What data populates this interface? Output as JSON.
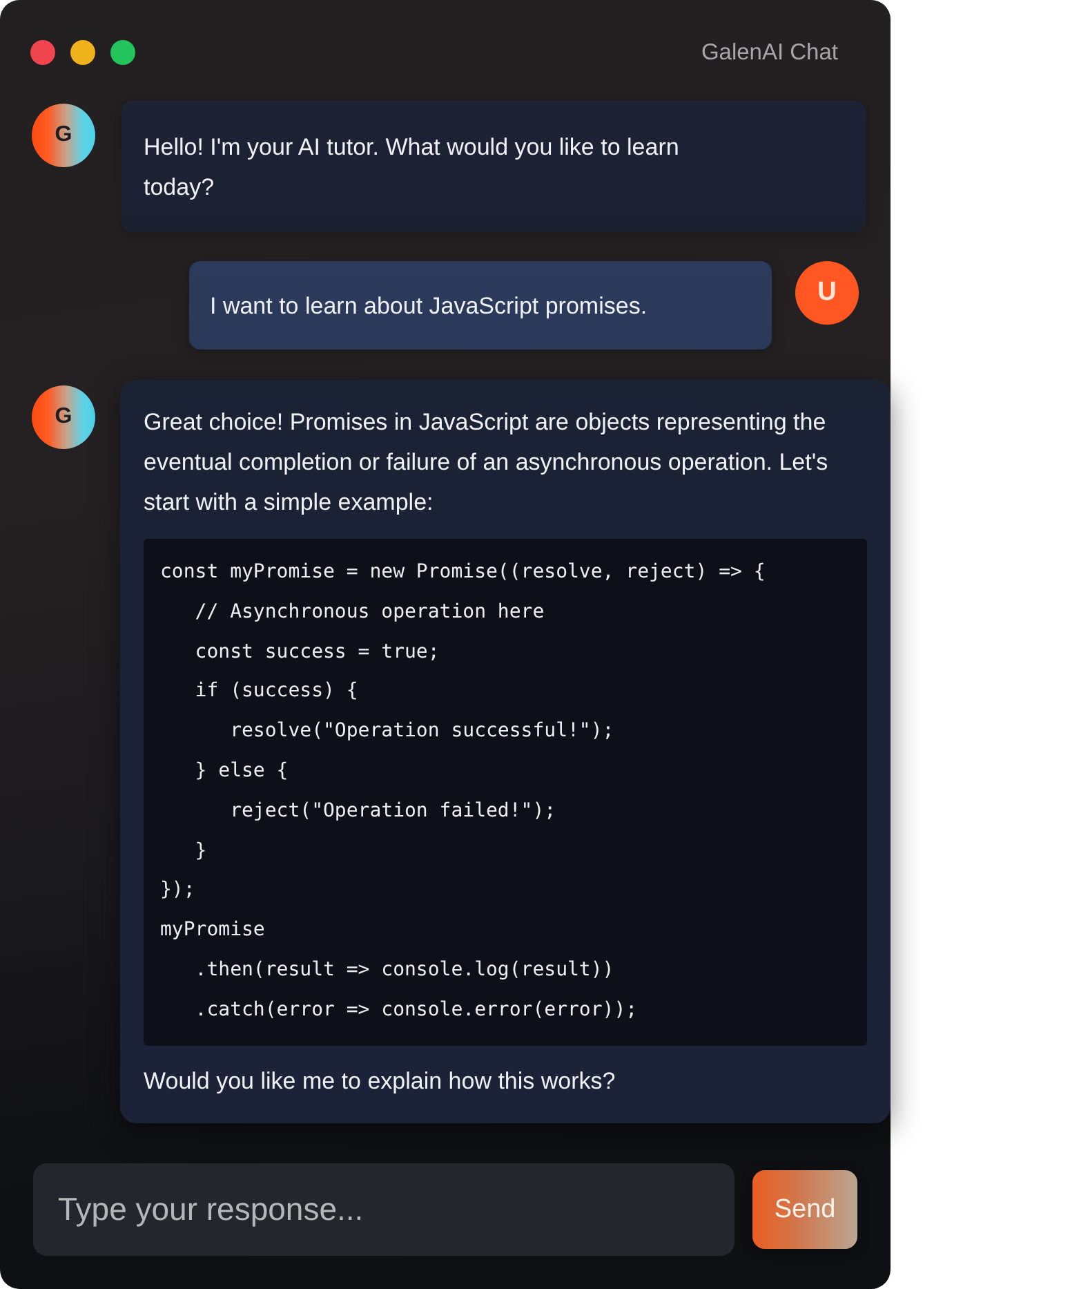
{
  "window": {
    "title": "GalenAI Chat",
    "window_buttons": [
      {
        "kind": "close"
      },
      {
        "kind": "minimize"
      },
      {
        "kind": "zoom"
      }
    ]
  },
  "messages": [
    {
      "kind": "assistant",
      "avatar": "G",
      "blocks": [
        {
          "kind": "text",
          "text": "Hello! I'm your AI tutor. What would you like to learn today?"
        }
      ]
    },
    {
      "kind": "user",
      "avatar": "U",
      "blocks": [
        {
          "kind": "text",
          "text": "I want to learn about JavaScript promises."
        }
      ]
    },
    {
      "kind": "assistant",
      "avatar": "G",
      "blocks": [
        {
          "kind": "text",
          "text": "Great choice! Promises in JavaScript are objects representing the eventual completion or failure of an asynchronous operation. Let's start with a simple example:"
        },
        {
          "kind": "code",
          "lines": [
            "const myPromise = new Promise((resolve, reject) => {",
            "   // Asynchronous operation here",
            "   const success = true;",
            "   if (success) {",
            "      resolve(\"Operation successful!\");",
            "   } else {",
            "      reject(\"Operation failed!\");",
            "   }",
            "});",
            "myPromise",
            "   .then(result => console.log(result))",
            "   .catch(error => console.error(error));"
          ]
        },
        {
          "kind": "text",
          "text": "Would you like me to explain how this works?"
        }
      ]
    }
  ],
  "composer": {
    "placeholder": "Type your response...",
    "send_button": "Send"
  }
}
